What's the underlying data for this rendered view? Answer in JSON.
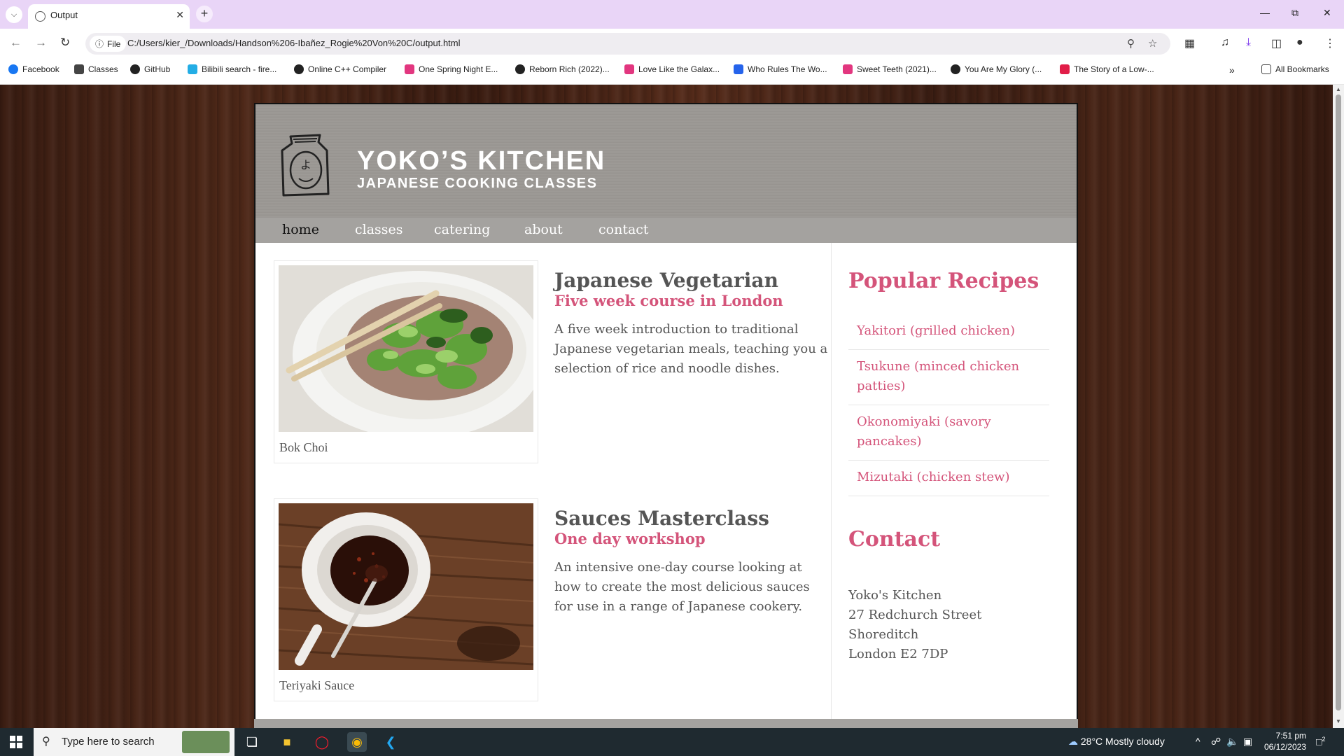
{
  "browser": {
    "tab_title": "Output",
    "site_chip": "File",
    "url": "C:/Users/kier_/Downloads/Handson%206-Ibañez_Rogie%20Von%20C/output.html",
    "bookmarks": [
      "Facebook",
      "Classes",
      "GitHub",
      "Bilibili search - fire...",
      "Online C++ Compiler",
      "One Spring Night E...",
      "Reborn Rich (2022)...",
      "Love Like the Galax...",
      "Who Rules The Wo...",
      "Sweet Teeth (2021)...",
      "You Are My Glory (...",
      "The Story of a Low-..."
    ],
    "all_bookmarks": "All Bookmarks"
  },
  "site": {
    "logo_glyph": "よ",
    "title": "YOKO’S KITCHEN",
    "subtitle": "JAPANESE COOKING CLASSES",
    "nav": [
      "home",
      "classes",
      "catering",
      "about",
      "contact"
    ],
    "active_nav": "home",
    "courses": [
      {
        "caption": "Bok Choi",
        "title": "Japanese Vegetarian",
        "subtitle": "Five week course in London",
        "description": "A five week introduction to traditional Japanese vegetarian meals, teaching you a selection of rice and noodle dishes."
      },
      {
        "caption": "Teriyaki Sauce",
        "title": "Sauces Masterclass",
        "subtitle": "One day workshop",
        "description": "An intensive one-day course looking at how to create the most delicious sauces for use in a range of Japanese cookery."
      }
    ],
    "sidebar": {
      "recipes_title": "Popular Recipes",
      "recipes": [
        "Yakitori (grilled chicken)",
        "Tsukune (minced chicken patties)",
        "Okonomiyaki (savory pancakes)",
        "Mizutaki (chicken stew)"
      ],
      "contact_title": "Contact",
      "address": [
        "Yoko's Kitchen",
        "27 Redchurch Street",
        "Shoreditch",
        "London E2 7DP"
      ]
    },
    "colors": {
      "accent": "#d4547a",
      "text": "#555555",
      "nav_bg": "#a4a29f",
      "header_bg": "#999999"
    }
  },
  "taskbar": {
    "search_placeholder": "Type here to search",
    "weather": "28°C  Mostly cloudy",
    "time": "7:51 pm",
    "date": "06/12/2023",
    "notifications": "2"
  }
}
